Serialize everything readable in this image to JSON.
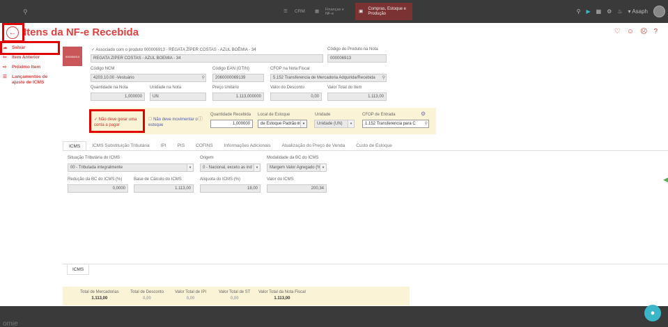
{
  "topbar": {
    "nav": [
      {
        "label": "CRM",
        "icon": "crm-icon"
      },
      {
        "label": "Finanças e NF-e",
        "icon": "finance-icon"
      },
      {
        "label": "Compras, Estoque e Produção",
        "icon": "box-icon"
      }
    ],
    "user": "Asaph"
  },
  "header": {
    "title": "Itens da NF-e Recebida",
    "icons": [
      "heart-icon",
      "smile-icon",
      "frown-icon",
      "help-icon"
    ]
  },
  "sidebar": {
    "items": [
      {
        "label": "Salvar",
        "icon": "cloud-save-icon"
      },
      {
        "label": "Item Anterior",
        "icon": "arrow-left-icon"
      },
      {
        "label": "Próximo Item",
        "icon": "arrow-right-icon"
      },
      {
        "label": "Lançamentos de ajuste de ICMS",
        "icon": "list-icon"
      }
    ]
  },
  "product": {
    "thumb_code": "000006913",
    "assoc_text": "Associado com o produto 000006913 - REGATA ZÍPER COSTAS - AZUL BOÊMIA - 34",
    "description": "REGATA ZIPER COSTAS - AZUL BOEMIA - 34",
    "code_label": "Código do Produto na Nota",
    "code_value": "000006913"
  },
  "fields": {
    "ncm": {
      "label": "Código NCM",
      "value": "4203.10.00  -Vestuário"
    },
    "ean": {
      "label": "Código EAN (GTIN)",
      "value": "2060000069139"
    },
    "cfop_nota": {
      "label": "CFOP na Nota Fiscal",
      "value": "5.152   Transferencia de Mercadoria Adquirida/Recebida"
    },
    "quantidade": {
      "label": "Quantidade na Nota",
      "value": "1,000000"
    },
    "unidade": {
      "label": "Unidade na Nota",
      "value": "UN"
    },
    "preco": {
      "label": "Preço Unitário",
      "value": "1.113,000000"
    },
    "desconto": {
      "label": "Valor do Desconto",
      "value": "0,00"
    },
    "total": {
      "label": "Valor Total do Item",
      "value": "1.113,00"
    }
  },
  "options": {
    "conta_pagar": "Não deve gerar uma conta a pagar",
    "estoque": "Não deve movimentar o estoque",
    "qtd_recebida": {
      "label": "Quantidade Recebida",
      "value": "1,000000"
    },
    "local_estoque": {
      "label": "Local de Estoque",
      "value": "de Estoque Padrão"
    },
    "unidade": {
      "label": "Unidade",
      "value": "Unidade (UN)"
    },
    "cfop_entrada": {
      "label": "CFOP de Entrada",
      "value": "1.152   Transferencia para C"
    }
  },
  "tabs": [
    "ICMS",
    "ICMS Substituição Tributária",
    "IPI",
    "PIS",
    "COFINS",
    "Informações Adicionais",
    "Atualização do Preço de Venda",
    "Custo de Estoque"
  ],
  "icms": {
    "situacao": {
      "label": "Situação Tributária do ICMS",
      "value": "00 - Tributada integralmente"
    },
    "origem": {
      "label": "Origem",
      "value": "0 - Nacional, exceto as ind"
    },
    "modalidade": {
      "label": "Modalidade da BC do ICMS",
      "value": "Margem Valor Agregado (%)"
    },
    "reducao": {
      "label": "Redução da BC do ICMS (%)",
      "value": "0,0000"
    },
    "base": {
      "label": "Base de Cálculo do ICMS",
      "value": "1.113,00"
    },
    "aliquota": {
      "label": "Alíquota do ICMS (%)",
      "value": "18,00"
    },
    "valor": {
      "label": "Valor do ICMS",
      "value": "200,34"
    }
  },
  "bottom_tab": "ICMS",
  "totals": [
    {
      "label": "Total de Mercadorias",
      "value": "1.113,00"
    },
    {
      "label": "Total de Desconto",
      "value": "0,00"
    },
    {
      "label": "Valor Total de IPI",
      "value": "0,00"
    },
    {
      "label": "Valor Total de ST",
      "value": "0,00"
    },
    {
      "label": "Valor Total da Nota Fiscal",
      "value": "1.113,00"
    }
  ],
  "footer": {
    "logo": "omie"
  },
  "colors": {
    "accent": "#e04040",
    "highlight": "#e00000",
    "band": "#fbf3d6"
  }
}
